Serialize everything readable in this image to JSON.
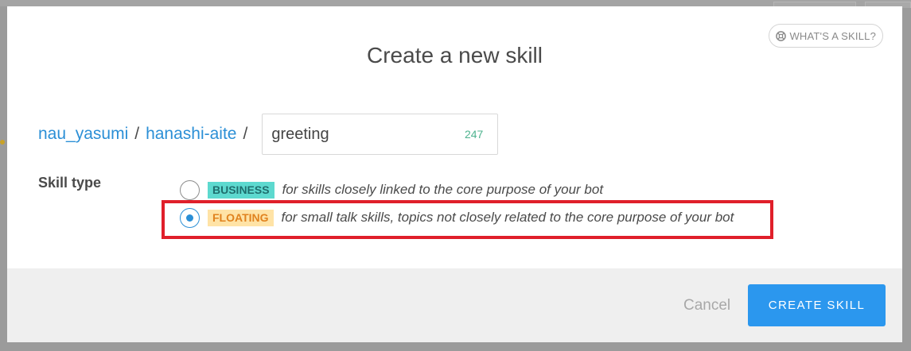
{
  "modal": {
    "title": "Create a new skill",
    "help_link": "WHAT'S A SKILL?"
  },
  "path": {
    "owner": "nau_yasumi",
    "separator1": "/",
    "bot": "hanashi-aite",
    "separator2": "/",
    "skill_name": "greeting",
    "remaining_chars": "247"
  },
  "skill_type": {
    "label": "Skill type",
    "options": [
      {
        "tag": "BUSINESS",
        "description": "for skills closely linked to the core purpose of your bot",
        "selected": false
      },
      {
        "tag": "FLOATING",
        "description": "for small talk skills, topics not closely related to the core purpose of your bot",
        "selected": true
      }
    ]
  },
  "footer": {
    "cancel_label": "Cancel",
    "create_label": "CREATE SKILL"
  },
  "colors": {
    "accent": "#2b97ee",
    "link": "#2b8fd6",
    "business_tag": "#5dd9cf",
    "floating_tag": "#ffe3a6",
    "highlight": "#e01f2a"
  }
}
